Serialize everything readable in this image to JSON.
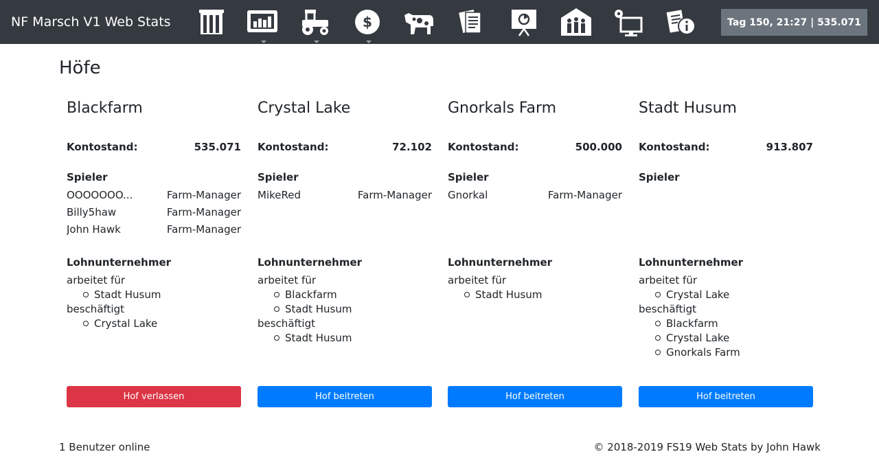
{
  "navbar": {
    "brand": "NF Marsch V1 Web Stats",
    "status": "Tag 150, 21:27 | 535.071",
    "colors": {
      "background": "#343a40",
      "icon": "#ffffff",
      "status_bg": "#6c757d"
    },
    "icons": [
      "storage-icon",
      "chart-icon",
      "tractor-icon",
      "money-icon",
      "cow-icon",
      "documents-icon",
      "presentation-icon",
      "farms-icon",
      "settings-monitor-icon",
      "info-document-icon"
    ]
  },
  "page": {
    "title": "Höfe"
  },
  "labels": {
    "balance": "Kontostand:",
    "players": "Spieler",
    "contractor": "Lohnunternehmer",
    "works_for": "arbeitet für",
    "employs": "beschäftigt"
  },
  "farms": [
    {
      "name": "Blackfarm",
      "balance": "535.071",
      "players": [
        {
          "name": "OOOOOOO...",
          "role": "Farm-Manager"
        },
        {
          "name": "Billy5haw",
          "role": "Farm-Manager"
        },
        {
          "name": "John Hawk",
          "role": "Farm-Manager"
        }
      ],
      "works_for": [
        "Stadt Husum"
      ],
      "employs": [
        "Crystal Lake"
      ],
      "button": "Hof verlassen"
    },
    {
      "name": "Crystal Lake",
      "balance": "72.102",
      "players": [
        {
          "name": "MikeRed",
          "role": "Farm-Manager"
        }
      ],
      "works_for": [
        "Blackfarm",
        "Stadt Husum"
      ],
      "employs": [
        "Stadt Husum"
      ],
      "button": "Hof beitreten"
    },
    {
      "name": "Gnorkals Farm",
      "balance": "500.000",
      "players": [
        {
          "name": "Gnorkal",
          "role": "Farm-Manager"
        }
      ],
      "works_for": [
        "Stadt Husum"
      ],
      "employs": [],
      "button": "Hof beitreten"
    },
    {
      "name": "Stadt Husum",
      "balance": "913.807",
      "players": [],
      "works_for": [
        "Crystal Lake"
      ],
      "employs": [
        "Blackfarm",
        "Crystal Lake",
        "Gnorkals Farm"
      ],
      "button": "Hof beitreten"
    }
  ],
  "footer": {
    "online": "1 Benutzer online",
    "copyright": "© 2018-2019 FS19 Web Stats by John Hawk"
  }
}
